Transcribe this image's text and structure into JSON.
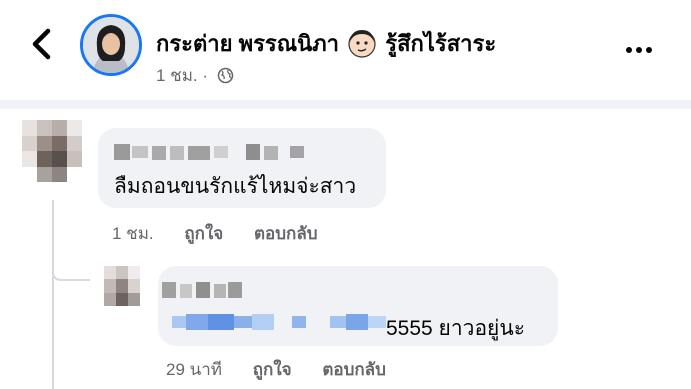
{
  "post": {
    "author_name": "กระต่าย พรรณนิภา",
    "status_text": "รู้สึกไร้สาระ",
    "time": "1 ชม.",
    "separator": "·"
  },
  "comments": [
    {
      "text": "ลืมถอนขนรักแร้ไหมจ่ะสาว",
      "time": "1 ชม.",
      "like_label": "ถูกใจ",
      "reply_label": "ตอบกลับ"
    }
  ],
  "reply": {
    "text": "5555 ยาวอยู่นะ",
    "time": "29 นาที",
    "like_label": "ถูกใจ",
    "reply_label": "ตอบกลับ"
  },
  "colors": {
    "accent": "#1877f2",
    "bubble": "#f0f2f5",
    "secondary_text": "#65676b"
  }
}
